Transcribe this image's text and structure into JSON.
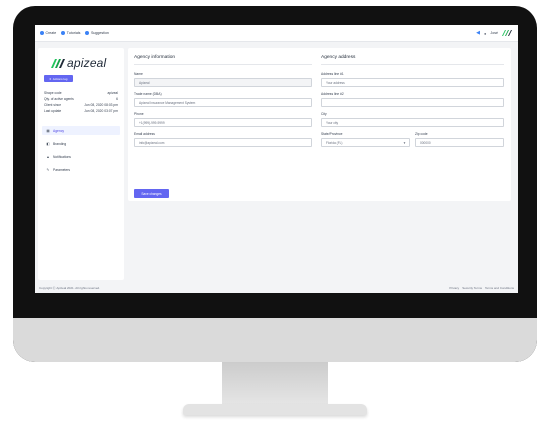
{
  "topbar": {
    "items": [
      {
        "label": "Create"
      },
      {
        "label": "Tutorials"
      },
      {
        "label": "Suggestion"
      }
    ],
    "user_label": "José"
  },
  "sidebar": {
    "logo_text": "apizeal",
    "badge_label": "Actions log",
    "info": [
      {
        "label": "Shape code",
        "value": "apizeal"
      },
      {
        "label": "Qty. of active agents",
        "value": "6"
      },
      {
        "label": "Client since",
        "value": "Jun 08, 2020 08:03 pm"
      },
      {
        "label": "Last update",
        "value": "Jun 08, 2020 03:07 pm"
      }
    ],
    "nav": [
      {
        "label": "Agency",
        "active": true
      },
      {
        "label": "Branding",
        "active": false
      },
      {
        "label": "Notifications",
        "active": false
      },
      {
        "label": "Parameters",
        "active": false
      }
    ]
  },
  "agency_info": {
    "title": "Agency information",
    "fields": [
      {
        "label": "Name",
        "value": "Apizeal"
      },
      {
        "label": "Trade name (DBA)",
        "value": "Apizeal Insurance Management System"
      },
      {
        "label": "Phone",
        "value": "+1(999)-999-9999"
      },
      {
        "label": "Email address",
        "value": "info@apizeal.com"
      }
    ],
    "save_label": "Save changes"
  },
  "agency_address": {
    "title": "Agency address",
    "address1": {
      "label": "Address line #1",
      "placeholder": "Your address"
    },
    "address2": {
      "label": "Address line #2",
      "placeholder": ""
    },
    "city": {
      "label": "City",
      "placeholder": "Your city"
    },
    "state": {
      "label": "State/Province",
      "value": "Florida (FL)"
    },
    "zip": {
      "label": "Zip code",
      "placeholder": "000000"
    }
  },
  "footer": {
    "copyright": "Copyright Ⓒ Apizeal 2021. All rights reserved.",
    "links": [
      "Privacy",
      "Security Terms",
      "Terms and Conditions"
    ]
  },
  "colors": {
    "accent": "#6366f1",
    "frame": "#111111",
    "chin": "#dadada"
  }
}
